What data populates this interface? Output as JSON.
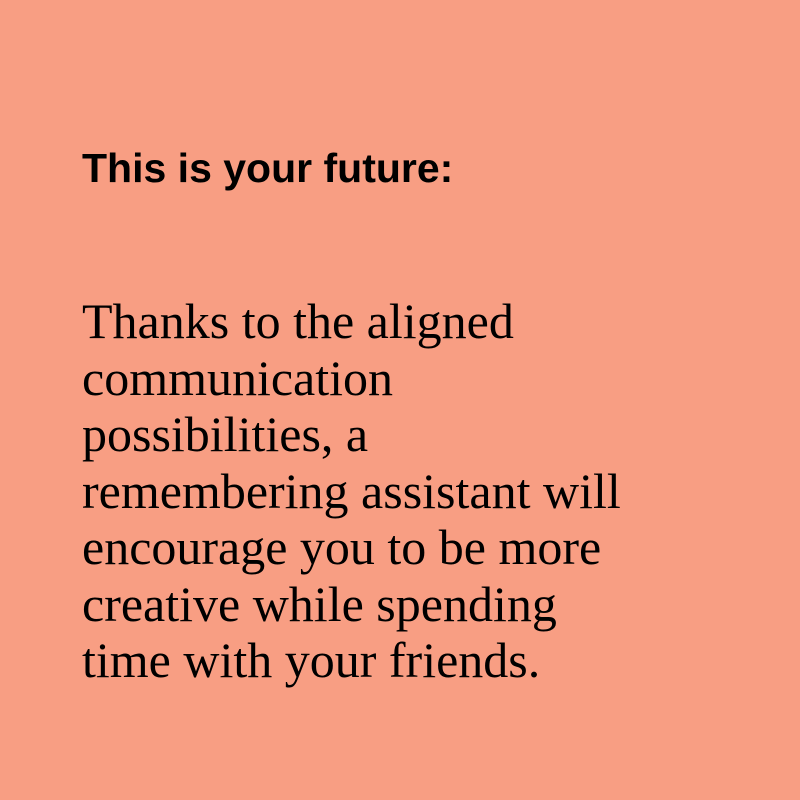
{
  "colors": {
    "background": "#f89e83",
    "text": "#000000"
  },
  "heading": "This is your future:",
  "body_lines": [
    "Thanks to the aligned",
    "communication",
    "possibilities, a",
    "remembering assistant will",
    "encourage you to be more",
    "creative while spending",
    "time with your friends."
  ]
}
